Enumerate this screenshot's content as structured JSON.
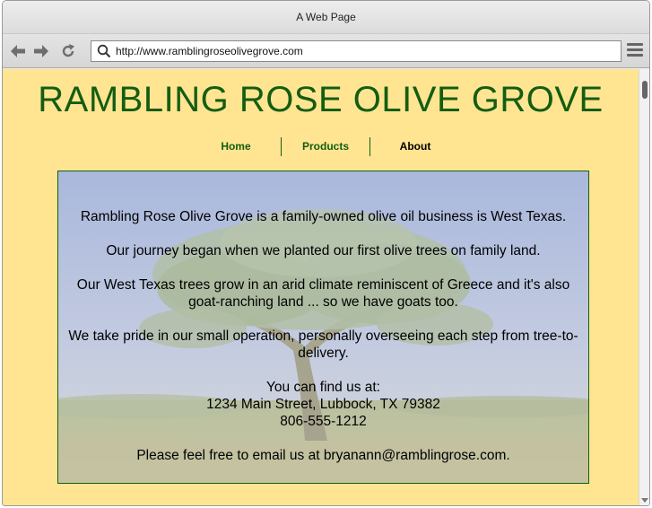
{
  "window": {
    "title": "A Web Page"
  },
  "toolbar": {
    "url": "http://www.ramblingroseolivegrove.com",
    "back_icon": "back-arrow-icon",
    "forward_icon": "forward-arrow-icon",
    "reload_icon": "reload-icon",
    "menu_icon": "hamburger-menu-icon"
  },
  "site": {
    "title": "RAMBLING ROSE OLIVE GROVE",
    "nav": [
      {
        "label": "Home"
      },
      {
        "label": "Products"
      },
      {
        "label": "About"
      }
    ],
    "content": {
      "p1": "Rambling Rose Olive Grove is a family-owned olive oil business is West Texas.",
      "p2": "Our journey began when we planted our first olive trees on family land.",
      "p3": "Our West Texas trees grow in an arid climate reminiscent of Greece and it's also goat-ranching land ... so we have goats too.",
      "p4": "We take pride in our small operation, personally overseeing each step from tree-to-delivery.",
      "find_us": "You can find us at:",
      "address": "1234 Main Street, Lubbock, TX 79382",
      "phone": "806-555-1212",
      "email_line": "Please feel free to email us at bryanann@ramblingrose.com."
    }
  },
  "colors": {
    "page_bg": "#ffe591",
    "brand_green": "#145d12",
    "active_nav": "#000000"
  }
}
